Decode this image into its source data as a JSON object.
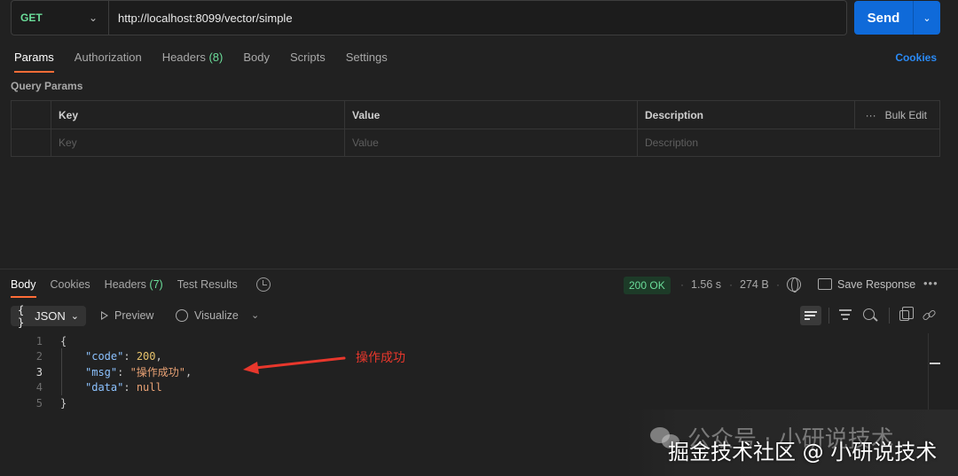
{
  "request": {
    "method": "GET",
    "url": "http://localhost:8099/vector/simple",
    "send_label": "Send"
  },
  "request_tabs": {
    "params": "Params",
    "authorization": "Authorization",
    "headers": "Headers",
    "headers_count": "(8)",
    "body": "Body",
    "scripts": "Scripts",
    "settings": "Settings",
    "cookies": "Cookies"
  },
  "query_params": {
    "title": "Query Params",
    "columns": [
      "Key",
      "Value",
      "Description"
    ],
    "placeholders": [
      "Key",
      "Value",
      "Description"
    ],
    "bulk_edit": "Bulk Edit"
  },
  "response_tabs": {
    "body": "Body",
    "cookies": "Cookies",
    "headers": "Headers",
    "headers_count": "(7)",
    "test_results": "Test Results"
  },
  "response_meta": {
    "status": "200 OK",
    "time": "1.56 s",
    "size": "274 B",
    "save_response": "Save Response"
  },
  "body_toolbar": {
    "format": "JSON",
    "preview": "Preview",
    "visualize": "Visualize"
  },
  "code": {
    "line_numbers": [
      "1",
      "2",
      "3",
      "4",
      "5"
    ],
    "open_brace": "{",
    "close_brace": "}",
    "code_key": "\"code\"",
    "code_value": "200",
    "msg_key": "\"msg\"",
    "msg_value": "\"操作成功\"",
    "data_key": "\"data\"",
    "data_value": "null"
  },
  "annotation": {
    "text": "操作成功",
    "color": "#e8372c"
  },
  "watermark": {
    "line1": "公众号 · 小研说技术",
    "line2": "掘金技术社区 @ 小研说技术"
  },
  "colors": {
    "accent_send": "#0f6ad9",
    "tab_indicator": "#ff6c37",
    "method_get": "#6bdd9a",
    "status_ok": "#6bdd9a"
  }
}
